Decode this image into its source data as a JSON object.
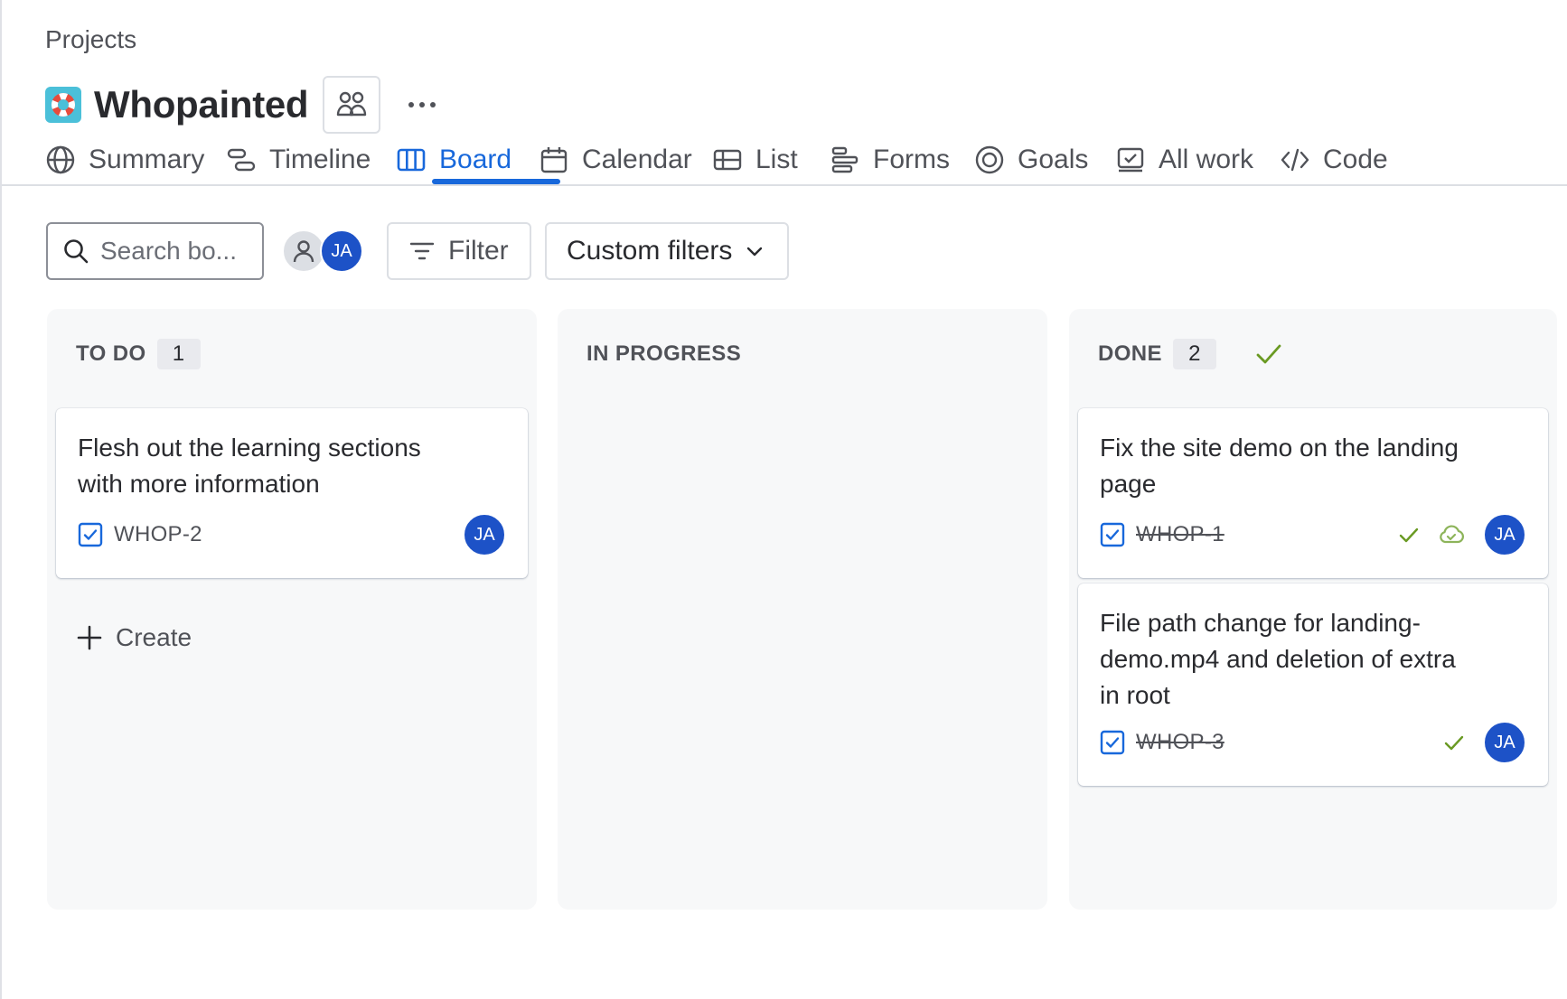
{
  "breadcrumb": "Projects",
  "project": {
    "title": "Whopainted",
    "icon": "lifebuoy-icon",
    "people_icon": "people-icon",
    "more_icon": "more-horizontal-icon"
  },
  "tabs": [
    {
      "label": "Summary",
      "icon": "globe-icon",
      "active": false
    },
    {
      "label": "Timeline",
      "icon": "timeline-icon",
      "active": false
    },
    {
      "label": "Board",
      "icon": "board-icon",
      "active": true
    },
    {
      "label": "Calendar",
      "icon": "calendar-icon",
      "active": false
    },
    {
      "label": "List",
      "icon": "list-icon",
      "active": false
    },
    {
      "label": "Forms",
      "icon": "forms-icon",
      "active": false
    },
    {
      "label": "Goals",
      "icon": "goals-icon",
      "active": false
    },
    {
      "label": "All work",
      "icon": "all-work-icon",
      "active": false
    },
    {
      "label": "Code",
      "icon": "code-icon",
      "active": false
    }
  ],
  "toolbar": {
    "search_placeholder": "Search bo...",
    "avatar_initials": "JA",
    "filter_label": "Filter",
    "custom_filters_label": "Custom filters"
  },
  "columns": {
    "todo": {
      "name": "TO DO",
      "count": "1",
      "cards": [
        {
          "title": "Flesh out the learning sections with more information",
          "key": "WHOP-2",
          "assignee": "JA"
        }
      ],
      "create_label": "Create"
    },
    "in_progress": {
      "name": "IN PROGRESS"
    },
    "done": {
      "name": "DONE",
      "count": "2",
      "cards": [
        {
          "title": "Fix the site demo on the landing page",
          "key": "WHOP-1",
          "assignee": "JA"
        },
        {
          "title": "File path change for landing-demo.mp4 and deletion of extra in root",
          "key": "WHOP-3",
          "assignee": "JA"
        }
      ]
    }
  },
  "colors": {
    "accent": "#1868db",
    "avatar": "#1d52c7",
    "done_check": "#6a9a23",
    "column_bg": "#f7f8f9"
  }
}
